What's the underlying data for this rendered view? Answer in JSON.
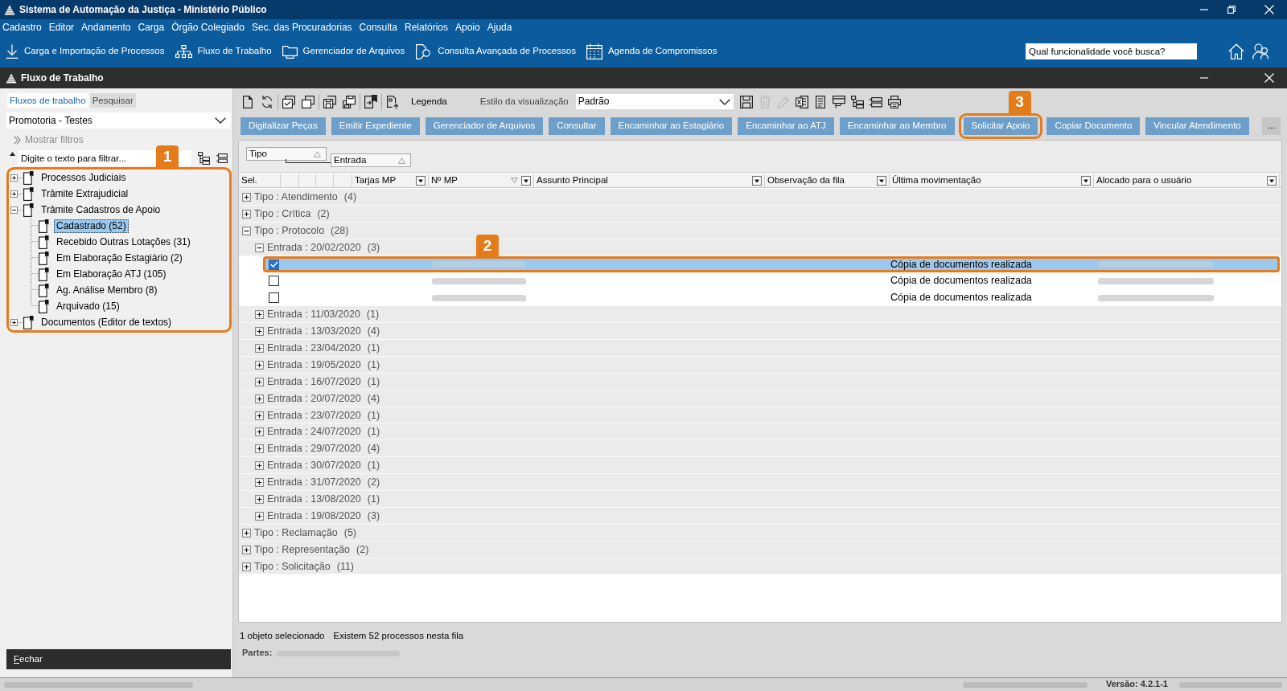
{
  "window": {
    "title": "Sistema de Automação da Justiça - Ministério Público"
  },
  "menu": [
    "Cadastro",
    "Editor",
    "Andamento",
    "Carga",
    "Órgão Colegiado",
    "Sec. das Procuradorias",
    "Consulta",
    "Relatórios",
    "Apoio",
    "Ajuda"
  ],
  "toolbar": [
    {
      "label": "Carga e Importação de Processos"
    },
    {
      "label": "Fluxo de Trabalho"
    },
    {
      "label": "Gerenciador de Arquivos"
    },
    {
      "label": "Consulta Avançada de Processos"
    },
    {
      "label": "Agenda de Compromissos"
    }
  ],
  "search": {
    "placeholder": "Qual funcionalidade você busca?"
  },
  "workspace": {
    "title": "Fluxo de Trabalho"
  },
  "sidebar": {
    "tabs": [
      {
        "label": "Fluxos de trabalho",
        "selected": true
      },
      {
        "label": "Pesquisar",
        "selected": false
      }
    ],
    "unit_select": {
      "value": "Promotoria - Testes"
    },
    "show_filters": "Mostrar filtros",
    "filter": {
      "placeholder": "Digite o texto para filtrar..."
    },
    "tree": {
      "callout": "1",
      "items": [
        {
          "label": "Processos Judiciais",
          "expanded": false,
          "selected": false
        },
        {
          "label": "Trâmite Extrajudicial",
          "expanded": false,
          "selected": false
        },
        {
          "label": "Trâmite Cadastros de Apoio",
          "expanded": true,
          "selected": false,
          "children": [
            {
              "label": "Cadastrado (52)",
              "selected": true
            },
            {
              "label": "Recebido Outras Lotações (31)",
              "selected": false
            },
            {
              "label": "Em Elaboração Estagiário (2)",
              "selected": false
            },
            {
              "label": "Em Elaboração ATJ (105)",
              "selected": false
            },
            {
              "label": "Ag. Análise Membro (8)",
              "selected": false
            },
            {
              "label": "Arquivado (15)",
              "selected": false
            }
          ]
        },
        {
          "label": "Documentos (Editor de textos)",
          "expanded": false,
          "selected": false
        }
      ]
    },
    "close_button": "Fechar"
  },
  "main": {
    "toolbar": {
      "legend": "Legenda",
      "view_style_label": "Estilo da visualização",
      "view_style": {
        "value": "Padrão"
      },
      "view_tools": [
        {
          "disabled": false
        },
        {
          "disabled": true
        },
        {
          "disabled": true
        },
        {
          "disabled": false
        },
        {
          "disabled": false
        },
        {
          "disabled": false
        },
        {
          "disabled": false
        },
        {
          "disabled": false
        },
        {
          "disabled": false
        }
      ]
    },
    "actions": [
      {
        "label": "Digitalizar Peças"
      },
      {
        "label": "Emitir Expediente"
      },
      {
        "label": "Gerenciador de Arquivos"
      },
      {
        "label": "Consultar"
      },
      {
        "label": "Encaminhar ao Estagiário"
      },
      {
        "label": "Encaminhar ao ATJ"
      },
      {
        "label": "Encaminhar ao Membro"
      },
      {
        "label": "Solicitar Apoio",
        "callout": "3"
      },
      {
        "label": "Copiar Documento"
      },
      {
        "label": "Vincular Atendimento"
      }
    ],
    "more_button": "...",
    "group_by": [
      {
        "label": "Tipo"
      },
      {
        "label": "Entrada"
      }
    ],
    "columns": [
      {
        "label": "Sel.",
        "filter": false,
        "sorted": false
      },
      {
        "filter": false,
        "sorted": false
      },
      {
        "filter": false,
        "sorted": false
      },
      {
        "filter": false,
        "sorted": false
      },
      {
        "filter": false,
        "sorted": false
      },
      {
        "label": "Tarjas MP",
        "filter": true,
        "sorted": false
      },
      {
        "label": "Nº MP",
        "filter": true,
        "sorted": true
      },
      {
        "label": "Assunto Principal",
        "filter": true,
        "sorted": false
      },
      {
        "label": "Observação da fila",
        "filter": true,
        "sorted": false
      },
      {
        "label": "Última movimentação",
        "filter": true,
        "sorted": false
      },
      {
        "label": "Alocado para o usuário",
        "filter": true,
        "sorted": false
      }
    ],
    "groups": [
      {
        "label": "Tipo : Atendimento",
        "count": "(4)",
        "expanded": false
      },
      {
        "label": "Tipo : Crítica",
        "count": "(2)",
        "expanded": false
      },
      {
        "label": "Tipo : Protocolo",
        "count": "(28)",
        "expanded": true,
        "children": [
          {
            "label": "Entrada : 20/02/2020",
            "count": "(3)",
            "expanded": true,
            "rows": [
              {
                "checked": true,
                "selected": true,
                "last_movement": "Cópia de documentos realizada",
                "callout": "2"
              },
              {
                "checked": false,
                "selected": false,
                "last_movement": "Cópia de documentos realizada"
              },
              {
                "checked": false,
                "selected": false,
                "last_movement": "Cópia de documentos realizada"
              }
            ]
          },
          {
            "label": "Entrada : 11/03/2020",
            "count": "(1)",
            "expanded": false
          },
          {
            "label": "Entrada : 13/03/2020",
            "count": "(4)",
            "expanded": false
          },
          {
            "label": "Entrada : 23/04/2020",
            "count": "(1)",
            "expanded": false
          },
          {
            "label": "Entrada : 19/05/2020",
            "count": "(1)",
            "expanded": false
          },
          {
            "label": "Entrada : 16/07/2020",
            "count": "(1)",
            "expanded": false
          },
          {
            "label": "Entrada : 20/07/2020",
            "count": "(4)",
            "expanded": false
          },
          {
            "label": "Entrada : 23/07/2020",
            "count": "(1)",
            "expanded": false
          },
          {
            "label": "Entrada : 24/07/2020",
            "count": "(1)",
            "expanded": false
          },
          {
            "label": "Entrada : 29/07/2020",
            "count": "(4)",
            "expanded": false
          },
          {
            "label": "Entrada : 30/07/2020",
            "count": "(1)",
            "expanded": false
          },
          {
            "label": "Entrada : 31/07/2020",
            "count": "(2)",
            "expanded": false
          },
          {
            "label": "Entrada : 13/08/2020",
            "count": "(1)",
            "expanded": false
          },
          {
            "label": "Entrada : 19/08/2020",
            "count": "(3)",
            "expanded": false
          }
        ]
      },
      {
        "label": "Tipo : Reclamação",
        "count": "(5)",
        "expanded": false
      },
      {
        "label": "Tipo : Representação",
        "count": "(2)",
        "expanded": false
      },
      {
        "label": "Tipo : Solicitação",
        "count": "(11)",
        "expanded": false
      }
    ],
    "selection_info": "1 objeto selecionado",
    "queue_info": "Existem 52 processos nesta fila",
    "parties_label": "Partes:"
  },
  "status_bar": {
    "version": "Versão: 4.2.1-1"
  }
}
